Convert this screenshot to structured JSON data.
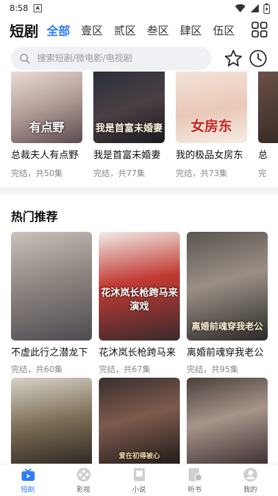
{
  "status": {
    "time": "8:58"
  },
  "header": {
    "title": "短剧",
    "tabs": [
      "全部",
      "壹区",
      "贰区",
      "叁区",
      "肆区",
      "伍区"
    ]
  },
  "search": {
    "placeholder": "搜索短剧/微电影/电视剧"
  },
  "top_row": [
    {
      "title": "总裁夫人有点野",
      "meta": "完结，共50集",
      "poster_text": "有点野"
    },
    {
      "title": "我是首富未婚妻",
      "meta": "完结，共77集",
      "poster_text": "我是首富未婚妻"
    },
    {
      "title": "我的极品女房东",
      "meta": "完结，共73集",
      "poster_text": "女房东"
    },
    {
      "title": "总",
      "meta": "完",
      "poster_text": ""
    }
  ],
  "hot": {
    "title": "热门推荐",
    "items": [
      {
        "title": "不虚此行之潜龙下",
        "meta": "完结，共60集",
        "poster_text": ""
      },
      {
        "title": "花沐岚长枪跨马来",
        "meta": "完结，共67集",
        "poster_text": "花沐岚长枪跨马来演戏"
      },
      {
        "title": "离婚前魂穿我老公",
        "meta": "完结，共95集",
        "poster_text": "离婚前魂穿我老公"
      }
    ],
    "row2_poster_text": [
      "",
      "爱在初得被心",
      ""
    ]
  },
  "tabbar": [
    {
      "label": "短剧"
    },
    {
      "label": "影视"
    },
    {
      "label": "小说"
    },
    {
      "label": "听书"
    },
    {
      "label": "我的"
    }
  ],
  "colors": {
    "accent": "#2f7ef5",
    "text": "#111111",
    "meta": "#888888",
    "search_bg": "#f0f1f5"
  }
}
